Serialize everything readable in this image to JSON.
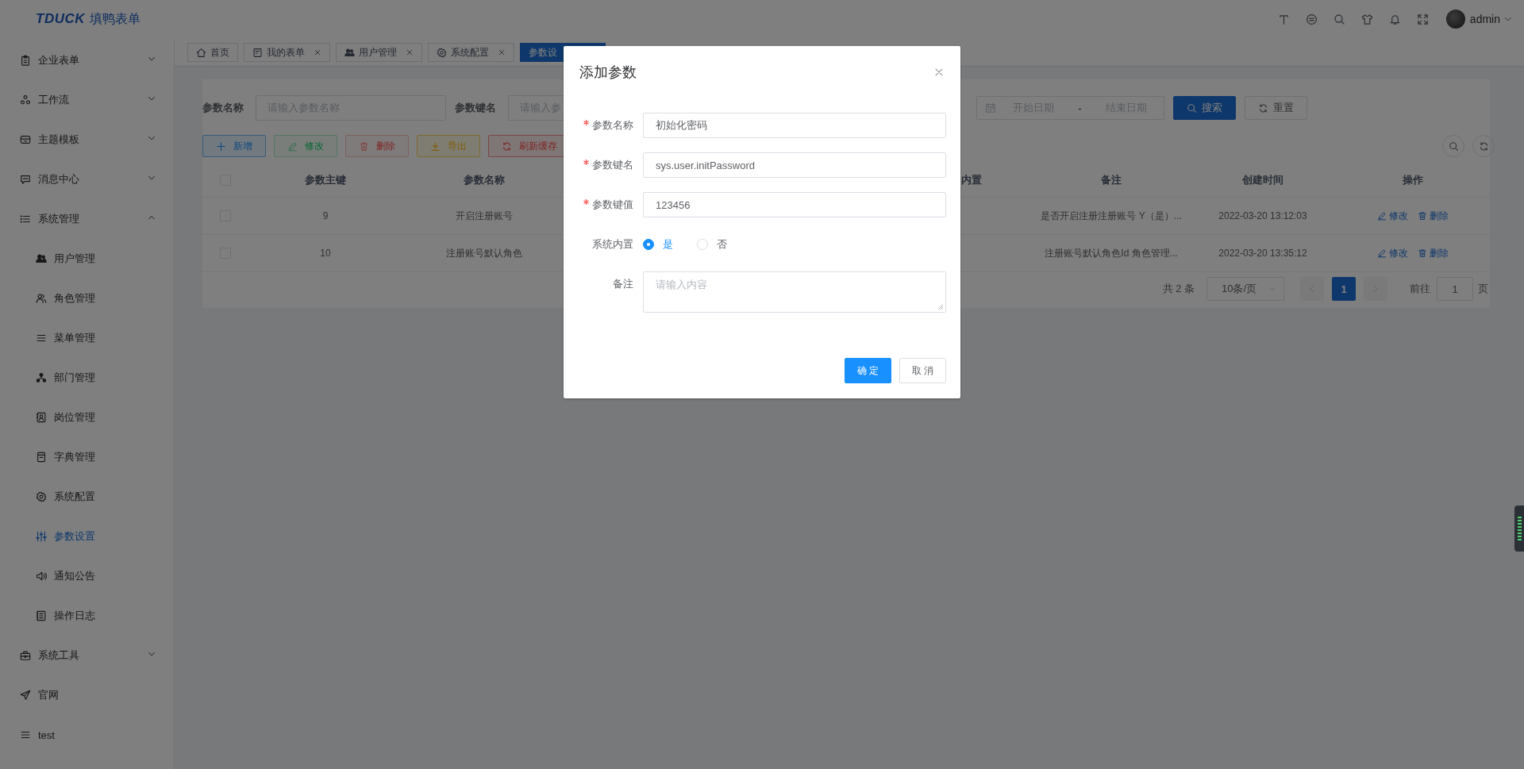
{
  "header": {
    "logo_mark": "TDUCK",
    "logo_text": "填鸭表单",
    "user": "admin"
  },
  "sidebar": {
    "items": [
      {
        "label": "企业表单",
        "kind": "group",
        "expanded": false
      },
      {
        "label": "工作流",
        "kind": "group",
        "expanded": false
      },
      {
        "label": "主题模板",
        "kind": "group",
        "expanded": false
      },
      {
        "label": "消息中心",
        "kind": "group",
        "expanded": false
      },
      {
        "label": "系统管理",
        "kind": "group",
        "expanded": true,
        "children": [
          {
            "label": "用户管理",
            "selected": false
          },
          {
            "label": "角色管理",
            "selected": false
          },
          {
            "label": "菜单管理",
            "selected": false
          },
          {
            "label": "部门管理",
            "selected": false
          },
          {
            "label": "岗位管理",
            "selected": false
          },
          {
            "label": "字典管理",
            "selected": false
          },
          {
            "label": "系统配置",
            "selected": false
          },
          {
            "label": "参数设置",
            "selected": true
          },
          {
            "label": "通知公告",
            "selected": false
          },
          {
            "label": "操作日志",
            "selected": false
          }
        ]
      },
      {
        "label": "系统工具",
        "kind": "group",
        "expanded": false
      },
      {
        "label": "官网",
        "kind": "link"
      },
      {
        "label": "test",
        "kind": "link"
      }
    ]
  },
  "tabs": [
    {
      "label": "首页",
      "selected": false,
      "closable": false
    },
    {
      "label": "我的表单",
      "selected": false,
      "closable": true
    },
    {
      "label": "用户管理",
      "selected": false,
      "closable": true
    },
    {
      "label": "系统配置",
      "selected": false,
      "closable": true
    },
    {
      "label": "参数设",
      "selected": true,
      "closable": false
    }
  ],
  "query": {
    "fields": [
      {
        "label": "参数名称",
        "placeholder": "请输入参数名称"
      },
      {
        "label": "参数键名",
        "placeholder": "请输入参"
      }
    ],
    "date_range": {
      "start_placeholder": "开始日期",
      "separator": "-",
      "end_placeholder": "结束日期"
    },
    "buttons": [
      {
        "label": "搜索",
        "kind": "primary"
      },
      {
        "label": "重置",
        "kind": "default"
      }
    ]
  },
  "toolbar": {
    "buttons": [
      {
        "label": "新增",
        "kind": "primary",
        "disabled": false
      },
      {
        "label": "修改",
        "kind": "success",
        "disabled": true
      },
      {
        "label": "删除",
        "kind": "danger",
        "disabled": true
      },
      {
        "label": "导出",
        "kind": "warning",
        "disabled": false
      },
      {
        "label": "刷新缓存",
        "kind": "danger",
        "disabled": false
      }
    ]
  },
  "table": {
    "all_checked": false,
    "columns": [
      "参数主键",
      "参数名称",
      "内置",
      "备注",
      "创建时间",
      "操作"
    ],
    "rows": [
      {
        "checked": false,
        "key": "9",
        "name": "开启注册账号",
        "remark": "是否开启注册注册账号 Y（是）...",
        "created": "2022-03-20 13:12:03",
        "actions": [
          "修改",
          "删除"
        ]
      },
      {
        "checked": false,
        "key": "10",
        "name": "注册账号默认角色",
        "remark": "注册账号默认角色Id 角色管理...",
        "created": "2022-03-20 13:35:12",
        "actions": [
          "修改",
          "删除"
        ]
      }
    ]
  },
  "pagination": {
    "total": "共 2 条",
    "page_size": "10条/页",
    "pages": [
      {
        "label": "1",
        "selected": true
      }
    ],
    "goto_label": "前往",
    "goto_value": "1",
    "page_suffix": "页"
  },
  "dialog": {
    "title": "添加参数",
    "fields": [
      {
        "label": "参数名称",
        "required": true,
        "kind": "input",
        "value": "初始化密码"
      },
      {
        "label": "参数键名",
        "required": true,
        "kind": "input",
        "value": "sys.user.initPassword"
      },
      {
        "label": "参数键值",
        "required": true,
        "kind": "input",
        "value": "123456"
      },
      {
        "label": "系统内置",
        "required": false,
        "kind": "radio",
        "options": [
          {
            "label": "是",
            "selected": true
          },
          {
            "label": "否",
            "selected": false
          }
        ]
      },
      {
        "label": "备注",
        "required": false,
        "kind": "textarea",
        "placeholder": "请输入内容"
      }
    ],
    "buttons": [
      {
        "label": "确 定",
        "kind": "primary"
      },
      {
        "label": "取 消",
        "kind": "default"
      }
    ]
  }
}
